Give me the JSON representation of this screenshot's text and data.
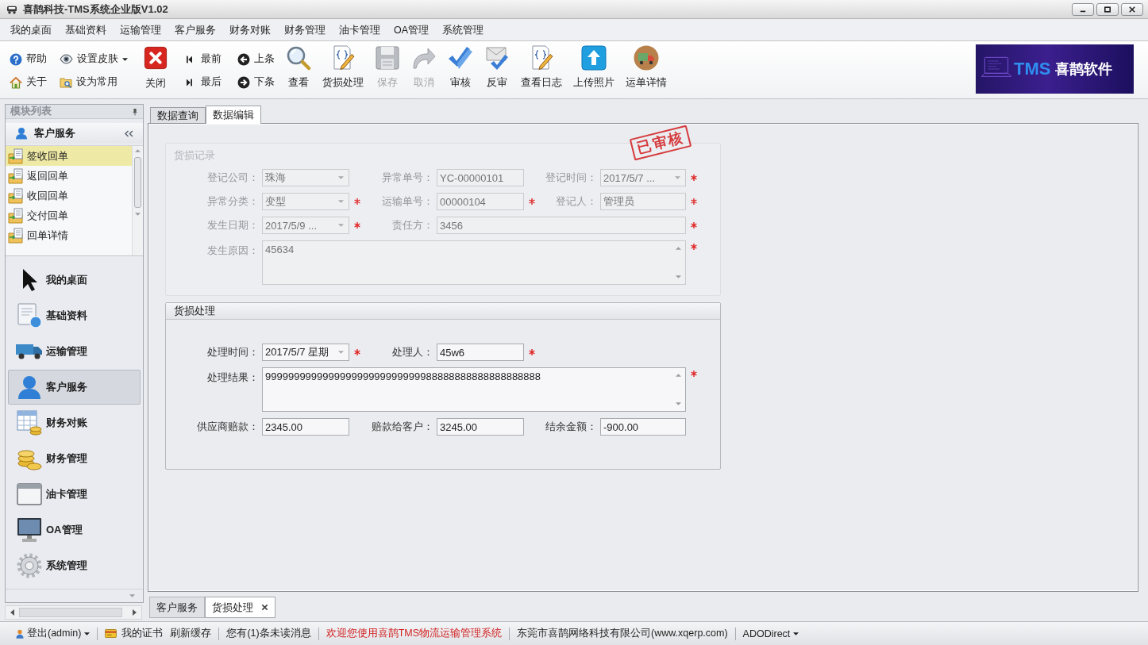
{
  "window": {
    "title": "喜鹊科技-TMS系统企业版V1.02"
  },
  "menu": [
    "我的桌面",
    "基础资料",
    "运输管理",
    "客户服务",
    "财务对账",
    "财务管理",
    "油卡管理",
    "OA管理",
    "系统管理"
  ],
  "toolbar": {
    "quick_links": [
      {
        "label": "帮助",
        "menu": false
      },
      {
        "label": "关于",
        "menu": false
      },
      {
        "label": "设置皮肤",
        "menu": true
      },
      {
        "label": "设为常用",
        "menu": false
      }
    ],
    "close": {
      "label": "关闭"
    },
    "navigation": [
      {
        "label": "最前"
      },
      {
        "label": "最后"
      },
      {
        "label": "上条"
      },
      {
        "label": "下条"
      }
    ],
    "actions": [
      {
        "label": "查看",
        "disabled": false
      },
      {
        "label": "货损处理",
        "disabled": false
      },
      {
        "label": "保存",
        "disabled": true
      },
      {
        "label": "取消",
        "disabled": true
      },
      {
        "label": "审核",
        "disabled": false
      },
      {
        "label": "反审",
        "disabled": false
      },
      {
        "label": "查看日志",
        "disabled": false
      },
      {
        "label": "上传照片",
        "disabled": false
      },
      {
        "label": "运单详情",
        "disabled": false
      }
    ]
  },
  "brand": {
    "mark": "TMS",
    "name": "喜鹊软件"
  },
  "module_panel": {
    "title": "模块列表",
    "group": "客户服务",
    "items": [
      {
        "label": "签收回单",
        "selected": true
      },
      {
        "label": "返回回单",
        "selected": false
      },
      {
        "label": "收回回单",
        "selected": false
      },
      {
        "label": "交付回单",
        "selected": false
      },
      {
        "label": "回单详情",
        "selected": false
      }
    ]
  },
  "modules": [
    {
      "label": "我的桌面",
      "selected": false
    },
    {
      "label": "基础资料",
      "selected": false
    },
    {
      "label": "运输管理",
      "selected": false
    },
    {
      "label": "客户服务",
      "selected": true
    },
    {
      "label": "财务对账",
      "selected": false
    },
    {
      "label": "财务管理",
      "selected": false
    },
    {
      "label": "油卡管理",
      "selected": false
    },
    {
      "label": "OA管理",
      "selected": false
    },
    {
      "label": "系统管理",
      "selected": false
    }
  ],
  "content_tabs": [
    {
      "label": "数据查询",
      "selected": false
    },
    {
      "label": "数据编辑",
      "selected": true
    }
  ],
  "damage_record": {
    "title": "货损记录",
    "disabled": true,
    "stamp": "已审核",
    "rows": [
      [
        {
          "label": "登记公司：",
          "value": "珠海",
          "kind": "combo",
          "required": false
        },
        {
          "label": "异常单号：",
          "value": "YC-00000101",
          "kind": "text",
          "required": false
        },
        {
          "label": "登记时间：",
          "value": "2017/5/7 ...",
          "kind": "combo",
          "required": true
        }
      ],
      [
        {
          "label": "异常分类：",
          "value": "变型",
          "kind": "combo",
          "required": true
        },
        {
          "label": "运输单号：",
          "value": "00000104",
          "kind": "text",
          "required": true
        },
        {
          "label": "登记人：",
          "value": "管理员",
          "kind": "text",
          "required": true
        }
      ],
      [
        {
          "label": "发生日期：",
          "value": "2017/5/9 ...",
          "kind": "combo",
          "required": true
        },
        {
          "label": "责任方：",
          "value": "3456",
          "kind": "long",
          "required": true
        }
      ],
      [
        {
          "label": "发生原因：",
          "value": "45634",
          "kind": "memo",
          "required": true
        }
      ]
    ]
  },
  "damage_handling": {
    "title": "货损处理",
    "disabled": false,
    "rows": [
      [
        {
          "label": "处理时间：",
          "value": "2017/5/7 星期",
          "kind": "combo",
          "required": true
        },
        {
          "label": "处理人：",
          "value": "45w6",
          "kind": "text",
          "required": true
        }
      ],
      [
        {
          "label": "处理结果：",
          "value": "999999999999999999999999999988888888888888888888",
          "kind": "memo",
          "required": true
        }
      ],
      [
        {
          "label": "供应商赔款：",
          "value": "2345.00",
          "kind": "text",
          "required": false
        },
        {
          "label": "赔款给客户：",
          "value": "3245.00",
          "kind": "text",
          "required": false
        },
        {
          "label": "结余金额：",
          "value": "-900.00",
          "kind": "text",
          "required": false
        }
      ]
    ]
  },
  "document_tabs": [
    {
      "label": "客户服务",
      "selected": false,
      "closable": false
    },
    {
      "label": "货损处理",
      "selected": true,
      "closable": true
    }
  ],
  "status_bar": [
    [
      {
        "kind": "user",
        "label": "登出(admin)"
      }
    ],
    [
      {
        "kind": "certificate",
        "label": "我的证书"
      },
      {
        "kind": "link",
        "label": "刷新缓存"
      }
    ],
    [
      {
        "kind": "link",
        "label": "您有(1)条未读消息"
      }
    ],
    [
      {
        "kind": "notice",
        "label": "欢迎您使用喜鹊TMS物流运输管理系统"
      }
    ],
    [
      {
        "kind": "text",
        "label": "东莞市喜鹊网络科技有限公司(www.xqerp.com)"
      }
    ],
    [
      {
        "kind": "menu",
        "label": "ADODirect"
      }
    ]
  ]
}
